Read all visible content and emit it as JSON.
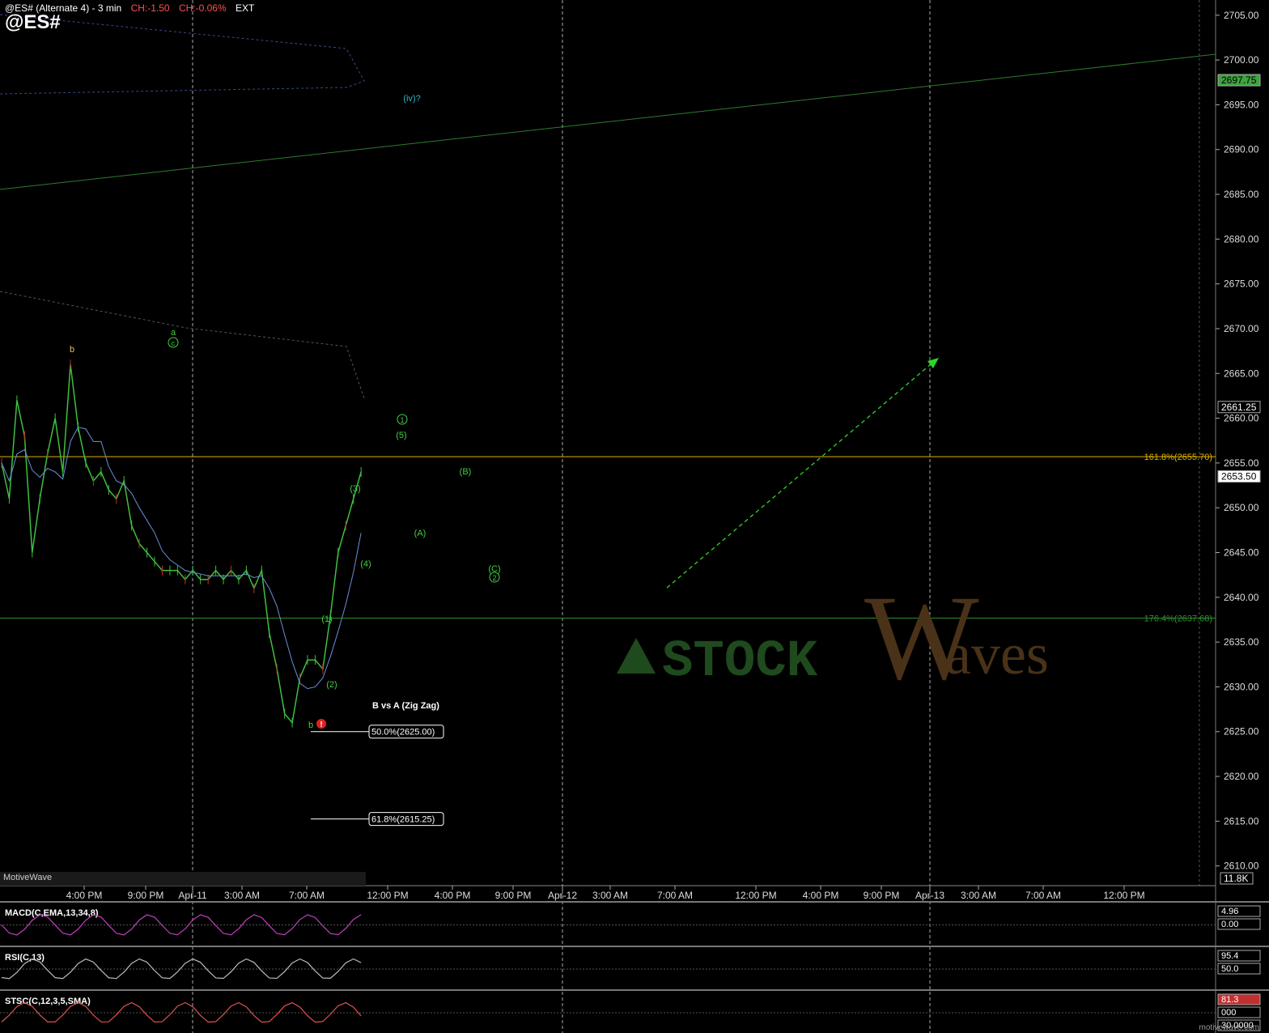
{
  "header": {
    "title": "@ES# (Alternate 4)  - 3 min",
    "change": "CH:-1.50",
    "change_pct": "CH:-0.06%",
    "session": "EXT",
    "symbol": "@ES#",
    "colors": {
      "title": "#ffffff",
      "change": "#ff5050",
      "session": "#ffffff"
    }
  },
  "footer": {
    "left_brand": "MotiveWave",
    "right_brand": "motivewave.com"
  },
  "watermark": {
    "text_left": "STOCK",
    "text_big": "W",
    "text_right": "aves"
  },
  "price_tags": [
    {
      "text": "2697.75",
      "price": 2697.75,
      "bg": "#3fa33f",
      "fg": "#000000"
    },
    {
      "text": "2661.25",
      "price": 2661.25,
      "bg": "#000000",
      "fg": "#ffffff"
    },
    {
      "text": "2653.50",
      "price": 2653.5,
      "bg": "#ffffff",
      "fg": "#000000"
    }
  ],
  "volume_tag": "11.8K",
  "fib_lines": [
    {
      "label": "161.8%(2655.70)",
      "price": 2655.7,
      "color": "#e0b000"
    },
    {
      "label": "176.4%(2637.68)",
      "price": 2637.68,
      "color": "#2f8f2f"
    }
  ],
  "zigzag": {
    "title": "B vs A (Zig Zag)",
    "levels": [
      {
        "label": "50.0%(2625.00)",
        "price": 2625.0
      },
      {
        "label": "61.8%(2615.25)",
        "price": 2615.25
      }
    ]
  },
  "wave_labels": [
    {
      "text": "(iv)?",
      "color": "#2fb8c8"
    },
    {
      "text": "a",
      "color": "#40d040"
    },
    {
      "text": "c",
      "color": "#40d040",
      "circled": true
    },
    {
      "text": "b",
      "color": "#d8c060"
    },
    {
      "text": "1",
      "color": "#40d040",
      "circled": true
    },
    {
      "text": "(5)",
      "color": "#40d040"
    },
    {
      "text": "(B)",
      "color": "#40d040"
    },
    {
      "text": "(3)",
      "color": "#40d040"
    },
    {
      "text": "(A)",
      "color": "#40d040"
    },
    {
      "text": "(4)",
      "color": "#40d040"
    },
    {
      "text": "(C)",
      "color": "#40d040"
    },
    {
      "text": "2",
      "color": "#40d040",
      "circled": true
    },
    {
      "text": "(1)",
      "color": "#40d040"
    },
    {
      "text": "(2)",
      "color": "#40d040"
    },
    {
      "text": "b",
      "color": "#40d040"
    }
  ],
  "indicators": {
    "macd": {
      "label": "MACD(C,EMA,13,34,8)",
      "tags": [
        "4.96",
        "0.00"
      ]
    },
    "rsi": {
      "label": "RSI(C,13)",
      "tags": [
        "95.4",
        "50.0"
      ]
    },
    "stsc": {
      "label": "STSC(C,12,3,5,SMA)",
      "tags": [
        "81.3",
        "000",
        "30.0000"
      ]
    }
  },
  "chart_data": {
    "type": "line",
    "instrument": "@ES#",
    "interval": "3 min",
    "y_axis": {
      "ticks": [
        2610,
        2615,
        2620,
        2625,
        2630,
        2635,
        2640,
        2645,
        2650,
        2655,
        2660,
        2665,
        2670,
        2675,
        2680,
        2685,
        2690,
        2695,
        2700,
        2705
      ],
      "tick_labels": [
        "2610.00",
        "2615.00",
        "2620.00",
        "2625.00",
        "2630.00",
        "2635.00",
        "2640.00",
        "2645.00",
        "2650.00",
        "2655.00",
        "2660.00",
        "2665.00",
        "2670.00",
        "2675.00",
        "2680.00",
        "2685.00",
        "2690.00",
        "2695.00",
        "2700.00",
        "2705.00"
      ],
      "range": [
        2607.8,
        2706.7
      ]
    },
    "x_axis": {
      "tick_labels": [
        "4:00 PM",
        "9:00 PM",
        "Apr-11",
        "3:00 AM",
        "7:00 AM",
        "12:00 PM",
        "4:00 PM",
        "9:00 PM",
        "Apr-12",
        "3:00 AM",
        "7:00 AM",
        "12:00 PM",
        "4:00 PM",
        "9:00 PM",
        "Apr-13",
        "3:00 AM",
        "7:00 AM",
        "12:00 PM"
      ],
      "day_dividers": [
        "Apr-11",
        "Apr-12",
        "Apr-13"
      ]
    },
    "price_series": [
      [
        0,
        2655
      ],
      [
        1,
        2651
      ],
      [
        2,
        2662
      ],
      [
        3,
        2658
      ],
      [
        4,
        2645
      ],
      [
        5,
        2651
      ],
      [
        6,
        2656
      ],
      [
        7,
        2660
      ],
      [
        8,
        2654
      ],
      [
        9,
        2666
      ],
      [
        10,
        2659
      ],
      [
        11,
        2655
      ],
      [
        12,
        2653
      ],
      [
        13,
        2654
      ],
      [
        14,
        2652
      ],
      [
        15,
        2651
      ],
      [
        16,
        2653
      ],
      [
        17,
        2648
      ],
      [
        18,
        2646
      ],
      [
        19,
        2645
      ],
      [
        20,
        2644
      ],
      [
        21,
        2643
      ],
      [
        22,
        2643
      ],
      [
        23,
        2643
      ],
      [
        24,
        2642
      ],
      [
        25,
        2643
      ],
      [
        26,
        2642
      ],
      [
        27,
        2642
      ],
      [
        28,
        2643
      ],
      [
        29,
        2642
      ],
      [
        30,
        2643
      ],
      [
        31,
        2642
      ],
      [
        32,
        2643
      ],
      [
        33,
        2641
      ],
      [
        34,
        2643
      ],
      [
        35,
        2636
      ],
      [
        36,
        2632
      ],
      [
        37,
        2627
      ],
      [
        38,
        2626
      ],
      [
        39,
        2631
      ],
      [
        40,
        2633
      ],
      [
        41,
        2633
      ],
      [
        42,
        2632
      ],
      [
        43,
        2638
      ],
      [
        44,
        2645
      ],
      [
        45,
        2648
      ],
      [
        46,
        2651
      ],
      [
        47,
        2654
      ]
    ],
    "fib_levels": [
      2655.7,
      2637.68,
      2625.0,
      2615.25
    ],
    "last_price": 2653.5,
    "grid": false
  }
}
